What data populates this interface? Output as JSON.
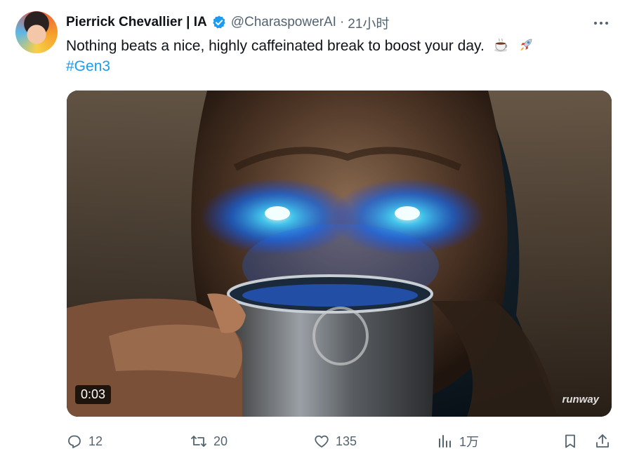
{
  "tweet": {
    "author_name": "Pierrick Chevallier | IA",
    "handle": "@CharaspowerAI",
    "separator": "·",
    "time": "21小时",
    "text": "Nothing beats a nice, highly caffeinated break to boost your day.",
    "emojis": [
      "coffee-cup-icon",
      "rocket-icon"
    ],
    "hashtag": "#Gen3",
    "verified": true
  },
  "media": {
    "duration": "0:03",
    "watermark": "runway"
  },
  "actions": {
    "replies": "12",
    "retweets": "20",
    "likes": "135",
    "views": "1万"
  },
  "colors": {
    "verified": "#1d9bf0",
    "link": "#1d9bf0",
    "muted": "#536471"
  }
}
